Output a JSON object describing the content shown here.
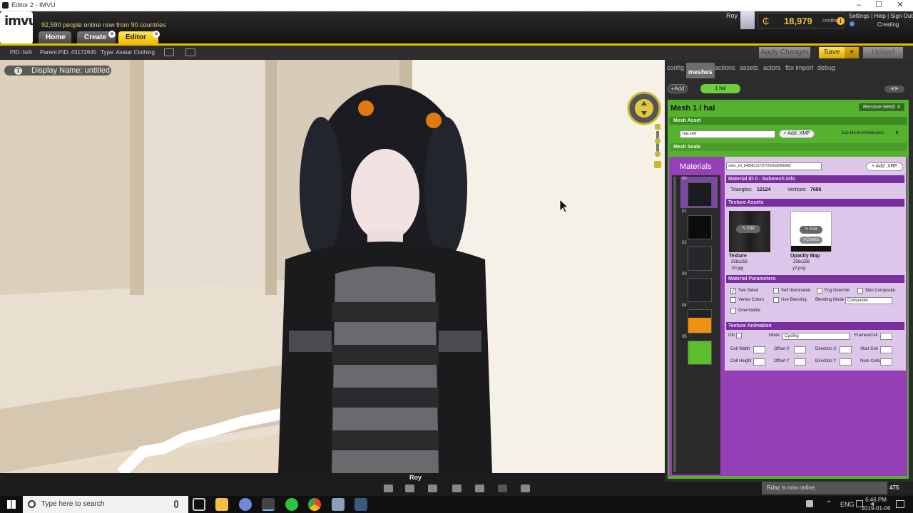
{
  "window": {
    "title": "Editor 2 - IMVU",
    "controls": [
      "–",
      "☐",
      "✕"
    ]
  },
  "app": {
    "logo": "imvu",
    "online_text": "92,590 people online now from 90 countries",
    "tabs": [
      {
        "label": "Home"
      },
      {
        "label": "Create"
      },
      {
        "label": "Editor 2"
      }
    ],
    "user_name": "Roy",
    "credits": "18,979",
    "credits_label": "credits",
    "links": "Settings | Help | Sign Out",
    "status": "Creating"
  },
  "editor_bar": {
    "pid": "PID: N/A",
    "parent_pid": "Parent PID: 43172645",
    "type": "Type: Avatar Clothing",
    "apply_label": "Apply Changes",
    "save_label": "Save",
    "upload_label": "Upload"
  },
  "scene": {
    "display_name": "Display Name: untitled",
    "avatar_name": "Roy"
  },
  "panel": {
    "tabs": [
      "config",
      "meshes",
      "actions",
      "assets",
      "actors",
      "fbx import",
      "debug"
    ],
    "active_tab": "meshes",
    "add_label": "Add",
    "mesh_chip": "1 hal",
    "mesh_title": "Mesh 1 / hal",
    "remove_mesh": "Remove Mesh",
    "mesh_asset_header": "Mesh Asset",
    "mesh_select": "hal.xmf",
    "add_xmf": "Add .XMF",
    "submeshes_label": "Sub-Meshes/Materials:",
    "submeshes_count": "6",
    "mesh_scale_header": "Mesh Scale",
    "materials_label": "Materials",
    "material_select": "chkn_xrf_b4858c31720722d0a3ff58d62",
    "add_xrf": "Add .XRF",
    "material_ids": [
      "00",
      "01",
      "02",
      "03",
      "04",
      "05"
    ],
    "material_id_header": "Material ID 0 - Submesh info",
    "triangles_label": "Triangles:",
    "triangles": "12124",
    "vertices_label": "Vertices:",
    "vertices": "7686",
    "texture_assets_header": "Texture Assets",
    "texture": {
      "title": "Texture",
      "size": "256x256",
      "file": "00.jpg",
      "edit": "Edit"
    },
    "opacity": {
      "title": "Opacity Map",
      "size": "256x256",
      "file": "y2.png",
      "edit": "Edit",
      "delete": "Delete"
    },
    "params_header": "Material Parameters",
    "params": {
      "two_sided": "Two Sided",
      "self_illuminated": "Self Illuminated",
      "fog_override": "Fog Override",
      "skin_composite": "Skin Composite",
      "vertex_colors": "Vertex Colors",
      "use_blending": "Use Blending",
      "blending_mode_label": "Blending Mode",
      "blending_mode": "Composite",
      "overridable": "Overridable"
    },
    "anim_header": "Texture Animation",
    "anim": {
      "on": "ON",
      "mode_label": "Mode",
      "mode": "Cycling",
      "frames_per_cell": "Frames/Cell",
      "cell_width": "Cell Width",
      "offset_x": "Offset X",
      "direction_x": "Direction X",
      "start_cell": "Start Cell",
      "cell_height": "Cell Height",
      "offset_y": "Offset Y",
      "direction_y": "Direction Y",
      "num_cells": "Num Cells"
    }
  },
  "notification": {
    "text": "Rdaz is now online.",
    "count": "475"
  },
  "taskbar": {
    "search_placeholder": "Type here to search",
    "lang": "ENG",
    "time": "6:46 PM",
    "date": "2019-01-06"
  }
}
